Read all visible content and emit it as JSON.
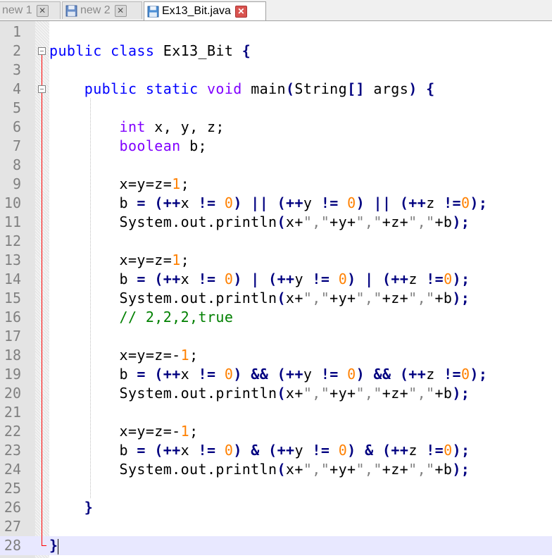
{
  "tabs": [
    {
      "label": "new 1",
      "active": false
    },
    {
      "label": "new 2",
      "active": false
    },
    {
      "label": "Ex13_Bit.java",
      "active": true
    }
  ],
  "lines": [
    {
      "n": "1",
      "segs": []
    },
    {
      "n": "2",
      "segs": [
        {
          "c": "kw",
          "t": "public"
        },
        {
          "c": "",
          "t": " "
        },
        {
          "c": "kw",
          "t": "class"
        },
        {
          "c": "",
          "t": " Ex13_Bit "
        },
        {
          "c": "op",
          "t": "{"
        }
      ]
    },
    {
      "n": "3",
      "segs": []
    },
    {
      "n": "4",
      "segs": [
        {
          "c": "",
          "t": "    "
        },
        {
          "c": "kw",
          "t": "public"
        },
        {
          "c": "",
          "t": " "
        },
        {
          "c": "kw",
          "t": "static"
        },
        {
          "c": "",
          "t": " "
        },
        {
          "c": "type",
          "t": "void"
        },
        {
          "c": "",
          "t": " main"
        },
        {
          "c": "op",
          "t": "("
        },
        {
          "c": "",
          "t": "String"
        },
        {
          "c": "op",
          "t": "[]"
        },
        {
          "c": "",
          "t": " args"
        },
        {
          "c": "op",
          "t": ")"
        },
        {
          "c": "",
          "t": " "
        },
        {
          "c": "op",
          "t": "{"
        }
      ]
    },
    {
      "n": "5",
      "segs": []
    },
    {
      "n": "6",
      "segs": [
        {
          "c": "",
          "t": "        "
        },
        {
          "c": "type",
          "t": "int"
        },
        {
          "c": "",
          "t": " x, y, z;"
        }
      ]
    },
    {
      "n": "7",
      "segs": [
        {
          "c": "",
          "t": "        "
        },
        {
          "c": "type",
          "t": "boolean"
        },
        {
          "c": "",
          "t": " b;"
        }
      ]
    },
    {
      "n": "8",
      "segs": []
    },
    {
      "n": "9",
      "segs": [
        {
          "c": "",
          "t": "        x=y=z="
        },
        {
          "c": "num",
          "t": "1"
        },
        {
          "c": "",
          "t": ";"
        }
      ]
    },
    {
      "n": "10",
      "segs": [
        {
          "c": "",
          "t": "        b "
        },
        {
          "c": "op",
          "t": "="
        },
        {
          "c": "",
          "t": " "
        },
        {
          "c": "op",
          "t": "(++"
        },
        {
          "c": "",
          "t": "x "
        },
        {
          "c": "op",
          "t": "!="
        },
        {
          "c": "",
          "t": " "
        },
        {
          "c": "num",
          "t": "0"
        },
        {
          "c": "op",
          "t": ")"
        },
        {
          "c": "",
          "t": " "
        },
        {
          "c": "op",
          "t": "||"
        },
        {
          "c": "",
          "t": " "
        },
        {
          "c": "op",
          "t": "(++"
        },
        {
          "c": "",
          "t": "y "
        },
        {
          "c": "op",
          "t": "!="
        },
        {
          "c": "",
          "t": " "
        },
        {
          "c": "num",
          "t": "0"
        },
        {
          "c": "op",
          "t": ")"
        },
        {
          "c": "",
          "t": " "
        },
        {
          "c": "op",
          "t": "||"
        },
        {
          "c": "",
          "t": " "
        },
        {
          "c": "op",
          "t": "(++"
        },
        {
          "c": "",
          "t": "z "
        },
        {
          "c": "op",
          "t": "!="
        },
        {
          "c": "num",
          "t": "0"
        },
        {
          "c": "op",
          "t": ");"
        }
      ]
    },
    {
      "n": "11",
      "segs": [
        {
          "c": "",
          "t": "        System.out.println"
        },
        {
          "c": "op",
          "t": "("
        },
        {
          "c": "",
          "t": "x+"
        },
        {
          "c": "str",
          "t": "\",\""
        },
        {
          "c": "",
          "t": "+y+"
        },
        {
          "c": "str",
          "t": "\",\""
        },
        {
          "c": "",
          "t": "+z+"
        },
        {
          "c": "str",
          "t": "\",\""
        },
        {
          "c": "",
          "t": "+b"
        },
        {
          "c": "op",
          "t": ");"
        }
      ]
    },
    {
      "n": "12",
      "segs": []
    },
    {
      "n": "13",
      "segs": [
        {
          "c": "",
          "t": "        x=y=z="
        },
        {
          "c": "num",
          "t": "1"
        },
        {
          "c": "",
          "t": ";"
        }
      ]
    },
    {
      "n": "14",
      "segs": [
        {
          "c": "",
          "t": "        b "
        },
        {
          "c": "op",
          "t": "="
        },
        {
          "c": "",
          "t": " "
        },
        {
          "c": "op",
          "t": "(++"
        },
        {
          "c": "",
          "t": "x "
        },
        {
          "c": "op",
          "t": "!="
        },
        {
          "c": "",
          "t": " "
        },
        {
          "c": "num",
          "t": "0"
        },
        {
          "c": "op",
          "t": ")"
        },
        {
          "c": "",
          "t": " "
        },
        {
          "c": "op",
          "t": "|"
        },
        {
          "c": "",
          "t": " "
        },
        {
          "c": "op",
          "t": "(++"
        },
        {
          "c": "",
          "t": "y "
        },
        {
          "c": "op",
          "t": "!="
        },
        {
          "c": "",
          "t": " "
        },
        {
          "c": "num",
          "t": "0"
        },
        {
          "c": "op",
          "t": ")"
        },
        {
          "c": "",
          "t": " "
        },
        {
          "c": "op",
          "t": "|"
        },
        {
          "c": "",
          "t": " "
        },
        {
          "c": "op",
          "t": "(++"
        },
        {
          "c": "",
          "t": "z "
        },
        {
          "c": "op",
          "t": "!="
        },
        {
          "c": "num",
          "t": "0"
        },
        {
          "c": "op",
          "t": ");"
        }
      ]
    },
    {
      "n": "15",
      "segs": [
        {
          "c": "",
          "t": "        System.out.println"
        },
        {
          "c": "op",
          "t": "("
        },
        {
          "c": "",
          "t": "x+"
        },
        {
          "c": "str",
          "t": "\",\""
        },
        {
          "c": "",
          "t": "+y+"
        },
        {
          "c": "str",
          "t": "\",\""
        },
        {
          "c": "",
          "t": "+z+"
        },
        {
          "c": "str",
          "t": "\",\""
        },
        {
          "c": "",
          "t": "+b"
        },
        {
          "c": "op",
          "t": ");"
        }
      ]
    },
    {
      "n": "16",
      "segs": [
        {
          "c": "",
          "t": "        "
        },
        {
          "c": "cmt",
          "t": "// 2,2,2,true"
        }
      ]
    },
    {
      "n": "17",
      "segs": []
    },
    {
      "n": "18",
      "segs": [
        {
          "c": "",
          "t": "        x=y=z=-"
        },
        {
          "c": "num",
          "t": "1"
        },
        {
          "c": "",
          "t": ";"
        }
      ]
    },
    {
      "n": "19",
      "segs": [
        {
          "c": "",
          "t": "        b "
        },
        {
          "c": "op",
          "t": "="
        },
        {
          "c": "",
          "t": " "
        },
        {
          "c": "op",
          "t": "(++"
        },
        {
          "c": "",
          "t": "x "
        },
        {
          "c": "op",
          "t": "!="
        },
        {
          "c": "",
          "t": " "
        },
        {
          "c": "num",
          "t": "0"
        },
        {
          "c": "op",
          "t": ")"
        },
        {
          "c": "",
          "t": " "
        },
        {
          "c": "op",
          "t": "&&"
        },
        {
          "c": "",
          "t": " "
        },
        {
          "c": "op",
          "t": "(++"
        },
        {
          "c": "",
          "t": "y "
        },
        {
          "c": "op",
          "t": "!="
        },
        {
          "c": "",
          "t": " "
        },
        {
          "c": "num",
          "t": "0"
        },
        {
          "c": "op",
          "t": ")"
        },
        {
          "c": "",
          "t": " "
        },
        {
          "c": "op",
          "t": "&&"
        },
        {
          "c": "",
          "t": " "
        },
        {
          "c": "op",
          "t": "(++"
        },
        {
          "c": "",
          "t": "z "
        },
        {
          "c": "op",
          "t": "!="
        },
        {
          "c": "num",
          "t": "0"
        },
        {
          "c": "op",
          "t": ");"
        }
      ]
    },
    {
      "n": "20",
      "segs": [
        {
          "c": "",
          "t": "        System.out.println"
        },
        {
          "c": "op",
          "t": "("
        },
        {
          "c": "",
          "t": "x+"
        },
        {
          "c": "str",
          "t": "\",\""
        },
        {
          "c": "",
          "t": "+y+"
        },
        {
          "c": "str",
          "t": "\",\""
        },
        {
          "c": "",
          "t": "+z+"
        },
        {
          "c": "str",
          "t": "\",\""
        },
        {
          "c": "",
          "t": "+b"
        },
        {
          "c": "op",
          "t": ");"
        }
      ]
    },
    {
      "n": "21",
      "segs": []
    },
    {
      "n": "22",
      "segs": [
        {
          "c": "",
          "t": "        x=y=z=-"
        },
        {
          "c": "num",
          "t": "1"
        },
        {
          "c": "",
          "t": ";"
        }
      ]
    },
    {
      "n": "23",
      "segs": [
        {
          "c": "",
          "t": "        b "
        },
        {
          "c": "op",
          "t": "="
        },
        {
          "c": "",
          "t": " "
        },
        {
          "c": "op",
          "t": "(++"
        },
        {
          "c": "",
          "t": "x "
        },
        {
          "c": "op",
          "t": "!="
        },
        {
          "c": "",
          "t": " "
        },
        {
          "c": "num",
          "t": "0"
        },
        {
          "c": "op",
          "t": ")"
        },
        {
          "c": "",
          "t": " "
        },
        {
          "c": "op",
          "t": "&"
        },
        {
          "c": "",
          "t": " "
        },
        {
          "c": "op",
          "t": "(++"
        },
        {
          "c": "",
          "t": "y "
        },
        {
          "c": "op",
          "t": "!="
        },
        {
          "c": "",
          "t": " "
        },
        {
          "c": "num",
          "t": "0"
        },
        {
          "c": "op",
          "t": ")"
        },
        {
          "c": "",
          "t": " "
        },
        {
          "c": "op",
          "t": "&"
        },
        {
          "c": "",
          "t": " "
        },
        {
          "c": "op",
          "t": "(++"
        },
        {
          "c": "",
          "t": "z "
        },
        {
          "c": "op",
          "t": "!="
        },
        {
          "c": "num",
          "t": "0"
        },
        {
          "c": "op",
          "t": ");"
        }
      ]
    },
    {
      "n": "24",
      "segs": [
        {
          "c": "",
          "t": "        System.out.println"
        },
        {
          "c": "op",
          "t": "("
        },
        {
          "c": "",
          "t": "x+"
        },
        {
          "c": "str",
          "t": "\",\""
        },
        {
          "c": "",
          "t": "+y+"
        },
        {
          "c": "str",
          "t": "\",\""
        },
        {
          "c": "",
          "t": "+z+"
        },
        {
          "c": "str",
          "t": "\",\""
        },
        {
          "c": "",
          "t": "+b"
        },
        {
          "c": "op",
          "t": ");"
        }
      ]
    },
    {
      "n": "25",
      "segs": []
    },
    {
      "n": "26",
      "segs": [
        {
          "c": "",
          "t": "    "
        },
        {
          "c": "op",
          "t": "}"
        }
      ]
    },
    {
      "n": "27",
      "segs": []
    },
    {
      "n": "28",
      "segs": [
        {
          "c": "op",
          "t": "}"
        }
      ]
    }
  ],
  "colors": {
    "keyword": "#0000ff",
    "type": "#8000ff",
    "number": "#ff8000",
    "operator": "#000080",
    "string": "#808080",
    "comment": "#008000",
    "current_line": "#e8e8ff"
  },
  "current_line": "28"
}
